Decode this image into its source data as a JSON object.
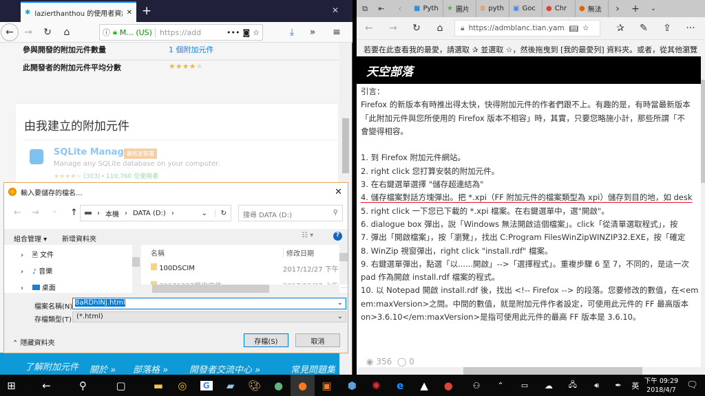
{
  "firefox": {
    "tab_title": "lazierthanthou 的使用者資訊",
    "url_identity": "M... (US)",
    "url_text": "https://add",
    "rows": [
      {
        "label": "參與開發的附加元件數量",
        "value": "1 個附加元件"
      },
      {
        "label": "此開發者的附加元件平均分數",
        "rating": 4
      }
    ],
    "section_title": "由我建立的附加元件",
    "addon": {
      "name": "SQLite Manager",
      "badge": "審核並簽署",
      "description": "Manage any SQLite database on your computer.",
      "rating": 4,
      "reviews": "(303)",
      "users": "110,760 位使用者"
    },
    "footer_links": [
      "了解附加元件",
      "關於 »",
      "部落格 »",
      "開發者交流中心 »",
      "常見問題集"
    ]
  },
  "dialog": {
    "title": "輸入要儲存的檔名...",
    "breadcrumb": [
      "本機",
      "DATA (D:)"
    ],
    "search_placeholder": "搜尋 DATA (D:)",
    "organize": "組合管理 ▾",
    "new_folder": "新增資料夾",
    "tree": [
      "文件",
      "音樂",
      "桌面"
    ],
    "columns": [
      "名稱",
      "修改日期"
    ],
    "files": [
      {
        "name": "100DSCIM",
        "date": "2017/12/27 下午 ..."
      },
      {
        "name": "20171227歷史文件",
        "date": "2017/12/27 上午 ..."
      }
    ],
    "filename_label": "檔案名稱(N):",
    "filename": "8aRDhINJ.html",
    "type_label": "存檔類型(T):",
    "type": "(*.html)",
    "hide_folders": "隱藏資料夾",
    "save": "存檔(S)",
    "cancel": "取消"
  },
  "edge": {
    "tabs": [
      "Pyth",
      "圖片",
      "pyth",
      "Goc",
      "Chr",
      "無法"
    ],
    "url": "https://admblanc.tian.yam.c",
    "favorites_hint": "若要在此查看我的最愛，請選取 ✰ 並選取 ☆，然後拖曳到 [我的最愛列] 資料夾。或者，從其他瀏覽",
    "logo": "天空部落",
    "lines": [
      "引言：",
      "Firefox 的新版本有時推出得太快，快得附加元件的作者們跟不上。有趣的是，有時當最新版本",
      "「此附加元件與您所使用的 Firefox 版本不相容」時，其實，只要您略施小計，那些所謂「不",
      "會變得相容。",
      "",
      "1. 到 Firefox 附加元件網站。",
      "2. right click 您打算安裝的附加元件。",
      "3. 在右鍵選單選擇 \"儲存超連結為\"",
      "4. 儲存檔案對話方塊彈出。把 *.xpi（FF 附加元件的檔案類型為 xpi）儲存到目的地，如 desk",
      "5. right click 一下您已下載的 *.xpi 檔案。在右鍵選單中，選\"開啟\"。",
      "6. dialogue box 彈出，說「Windows 無法開啟這個檔案」。click「從清單選取程式」，按",
      "7. 彈出「開啟檔案」，按「瀏覽」，找出 C:Program FilesWinZipWINZIP32.EXE，按「確定",
      "8. WinZip 視窗彈出，right click \"install.rdf\" 檔案。",
      "9. 右鍵選單彈出，點選「以......開啟」-->「選擇程式」。重複步驟 6 至 7，不同的，是這一次",
      "pad 作為開啟 install.rdf 檔案的程式。",
      "10. 以 Notepad 開啟 install.rdf 後，找出 <!-- Firefox --> 的段落。您要修改的數值，在<em",
      "em:maxVersion>之間。中間的數值，就是附加元件作者設定，可使用此元件的 FF 最高版本",
      "on>3.6.10</em:maxVersion>是指可使用此元件的最高 FF 版本是 3.6.10。"
    ],
    "views": "356",
    "comments": "0"
  },
  "taskbar": {
    "time": "下午 09:29",
    "date": "2018/4/7",
    "ime": "英"
  },
  "colors": {
    "ff_title": "#20203a",
    "footer_blue": "#0e9ad6",
    "accent": "#0a84ff",
    "underline": "#e81123"
  }
}
